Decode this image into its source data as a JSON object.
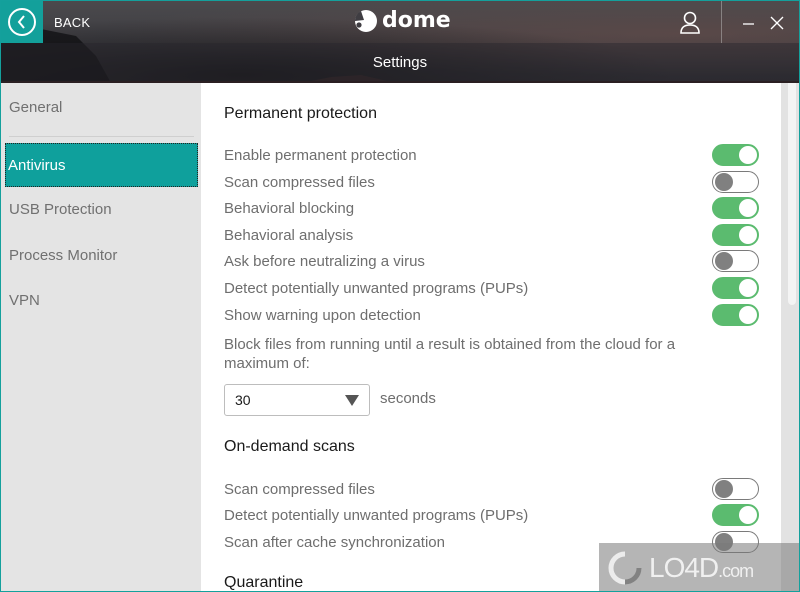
{
  "header": {
    "back_label": "BACK",
    "logo_text": "dome",
    "page_title": "Settings"
  },
  "sidebar": {
    "items": [
      {
        "label": "General",
        "active": false
      },
      {
        "label": "Antivirus",
        "active": true
      },
      {
        "label": "USB Protection",
        "active": false
      },
      {
        "label": "Process Monitor",
        "active": false
      },
      {
        "label": "VPN",
        "active": false
      }
    ]
  },
  "content": {
    "permanent_protection": {
      "title": "Permanent protection",
      "options": [
        {
          "label": "Enable permanent protection",
          "enabled": true
        },
        {
          "label": "Scan compressed files",
          "enabled": false
        },
        {
          "label": "Behavioral blocking",
          "enabled": true
        },
        {
          "label": "Behavioral analysis",
          "enabled": true
        },
        {
          "label": "Ask before neutralizing a virus",
          "enabled": false
        },
        {
          "label": "Detect potentially unwanted programs (PUPs)",
          "enabled": true
        },
        {
          "label": "Show warning upon detection",
          "enabled": true
        }
      ],
      "cloud_block_text": "Block files from running until a result is obtained from the cloud for a maximum of:",
      "cloud_block_value": "30",
      "cloud_block_unit": "seconds"
    },
    "on_demand_scans": {
      "title": "On-demand scans",
      "options": [
        {
          "label": "Scan compressed files",
          "enabled": false
        },
        {
          "label": "Detect potentially unwanted programs (PUPs)",
          "enabled": true
        },
        {
          "label": "Scan after cache synchronization",
          "enabled": false
        }
      ]
    },
    "quarantine": {
      "title": "Quarantine"
    }
  },
  "watermark": {
    "text": "LO4D",
    "suffix": ".com"
  },
  "colors": {
    "accent": "#13a09b",
    "toggle_on": "#5bbb6f",
    "toggle_off_knob": "#808080"
  }
}
